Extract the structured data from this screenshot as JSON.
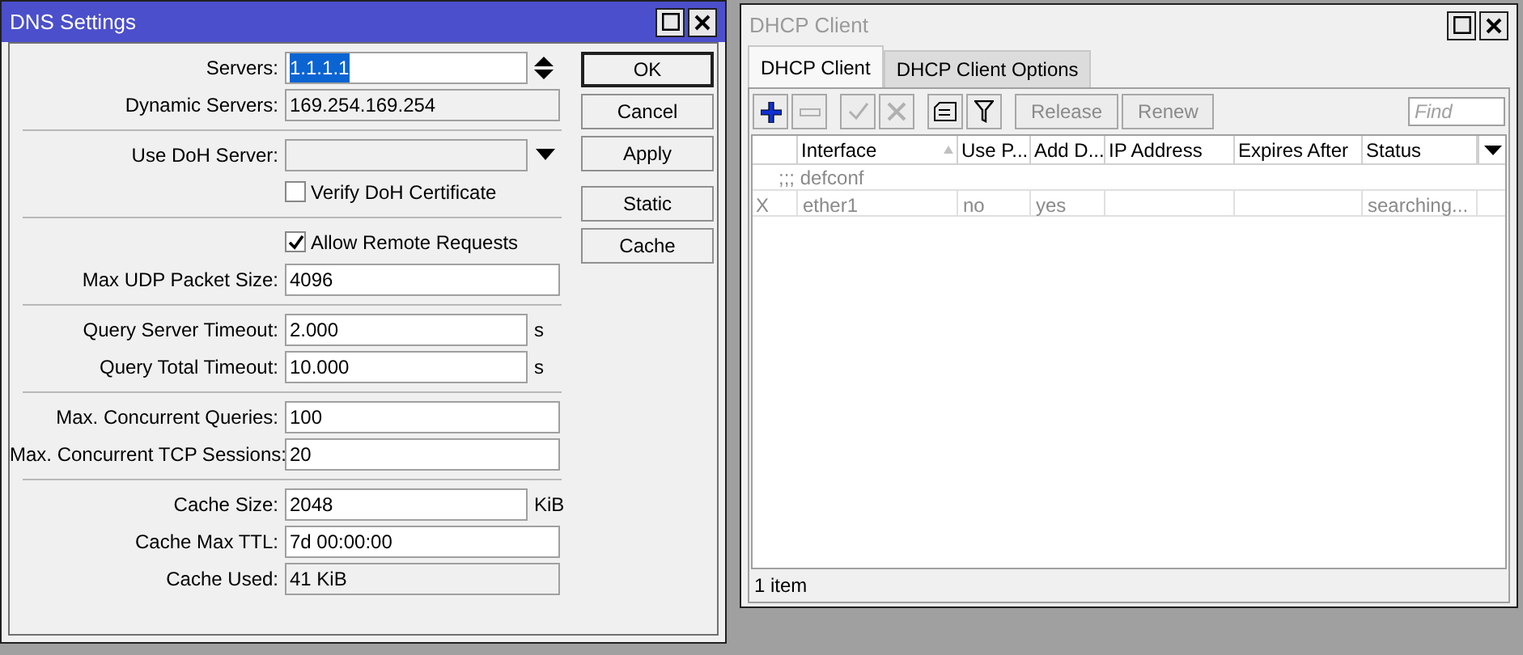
{
  "dns_window": {
    "title": "DNS Settings",
    "active": true,
    "sections": [
      [
        {
          "kind": "spin",
          "label": "Servers:",
          "value": "1.1.1.1",
          "readonly": false,
          "highlighted": true
        },
        {
          "kind": "input",
          "label": "Dynamic Servers:",
          "value": "169.254.169.254",
          "readonly": true,
          "highlighted": false
        }
      ],
      [
        {
          "kind": "combo",
          "label": "Use DoH Server:",
          "readonly": true
        },
        {
          "kind": "checkbox",
          "label": "Verify DoH Certificate",
          "checked": false
        }
      ],
      [
        {
          "kind": "checkbox",
          "label": "Allow Remote Requests",
          "checked": true
        },
        {
          "kind": "input",
          "label": "Max UDP Packet Size:",
          "value": "4096",
          "readonly": false,
          "highlighted": false
        }
      ],
      [
        {
          "kind": "input",
          "label": "Query Server Timeout:",
          "value": "2.000",
          "unit": "s",
          "readonly": false,
          "highlighted": false
        },
        {
          "kind": "input",
          "label": "Query Total Timeout:",
          "value": "10.000",
          "unit": "s",
          "readonly": false,
          "highlighted": false
        }
      ],
      [
        {
          "kind": "input",
          "label": "Max. Concurrent Queries:",
          "value": "100",
          "readonly": false,
          "highlighted": false
        },
        {
          "kind": "input",
          "label": "Max. Concurrent TCP Sessions:",
          "value": "20",
          "readonly": false,
          "highlighted": false
        }
      ],
      [
        {
          "kind": "input",
          "label": "Cache Size:",
          "value": "2048",
          "unit": "KiB",
          "readonly": false,
          "highlighted": false
        },
        {
          "kind": "input",
          "label": "Cache Max TTL:",
          "value": "7d 00:00:00",
          "readonly": false,
          "highlighted": false
        },
        {
          "kind": "input",
          "label": "Cache Used:",
          "value": "41 KiB",
          "readonly": true,
          "highlighted": false
        }
      ]
    ],
    "button_groups": [
      [
        {
          "label": "OK",
          "default": true
        },
        {
          "label": "Cancel",
          "default": false
        },
        {
          "label": "Apply",
          "default": false
        }
      ],
      [
        {
          "label": "Static",
          "default": false
        },
        {
          "label": "Cache",
          "default": false
        }
      ]
    ]
  },
  "dhcp_window": {
    "title": "DHCP Client",
    "active": false,
    "tabs": [
      {
        "label": "DHCP Client",
        "selected": true
      },
      {
        "label": "DHCP Client Options",
        "selected": false
      }
    ],
    "toolbar": [
      {
        "kind": "add",
        "disabled": false
      },
      {
        "kind": "remove",
        "disabled": true
      },
      {
        "kind": "enable",
        "disabled": true
      },
      {
        "kind": "disable",
        "disabled": true
      },
      {
        "kind": "comment",
        "disabled": false
      },
      {
        "kind": "filter",
        "disabled": false
      },
      {
        "kind": "text",
        "label": "Release",
        "disabled": true
      },
      {
        "kind": "text",
        "label": "Renew",
        "disabled": true
      }
    ],
    "find": {
      "placeholder": "Find"
    },
    "table": {
      "columns": [
        "Interface",
        "Use P...",
        "Add D...",
        "IP Address",
        "Expires After",
        "Status"
      ],
      "rows": [
        {
          "comment": ";;; defconf",
          "flag": "X",
          "disabled": true,
          "cells": [
            "ether1",
            "no",
            "yes",
            "",
            "",
            "searching..."
          ]
        }
      ]
    },
    "status_bar": "1 item"
  }
}
